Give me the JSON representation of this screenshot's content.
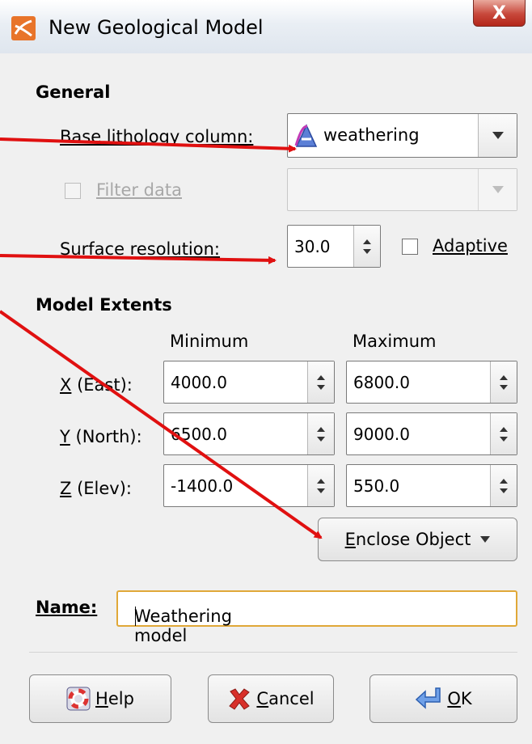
{
  "window": {
    "title": "New Geological Model",
    "close_label": "X"
  },
  "general": {
    "heading": "General",
    "base_lithology_label": "Base lithology column:",
    "base_lithology_value": "weathering",
    "filter_data_label": "Filter data",
    "filter_data_checked": false,
    "surface_resolution_label": "Surface resolution:",
    "surface_resolution_value": "30.0",
    "adaptive_label": "Adaptive",
    "adaptive_checked": false
  },
  "extents": {
    "heading": "Model Extents",
    "col_min": "Minimum",
    "col_max": "Maximum",
    "rows": [
      {
        "label_key": "X",
        "label_rest": " (East):",
        "min": "4000.0",
        "max": "6800.0"
      },
      {
        "label_key": "Y",
        "label_rest": " (North):",
        "min": "6500.0",
        "max": "9000.0"
      },
      {
        "label_key": "Z",
        "label_rest": " (Elev):",
        "min": "-1400.0",
        "max": "550.0"
      }
    ],
    "enclose_key": "E",
    "enclose_rest": "nclose Object"
  },
  "name": {
    "label": "Name:",
    "value": "Weathering model"
  },
  "buttons": {
    "help_key": "H",
    "help_rest": "elp",
    "cancel_key": "C",
    "cancel_rest": "ancel",
    "ok_key": "O",
    "ok_rest": "K"
  },
  "colors": {
    "annotation_arrow": "#e01010",
    "focus_border": "#e0a838"
  }
}
